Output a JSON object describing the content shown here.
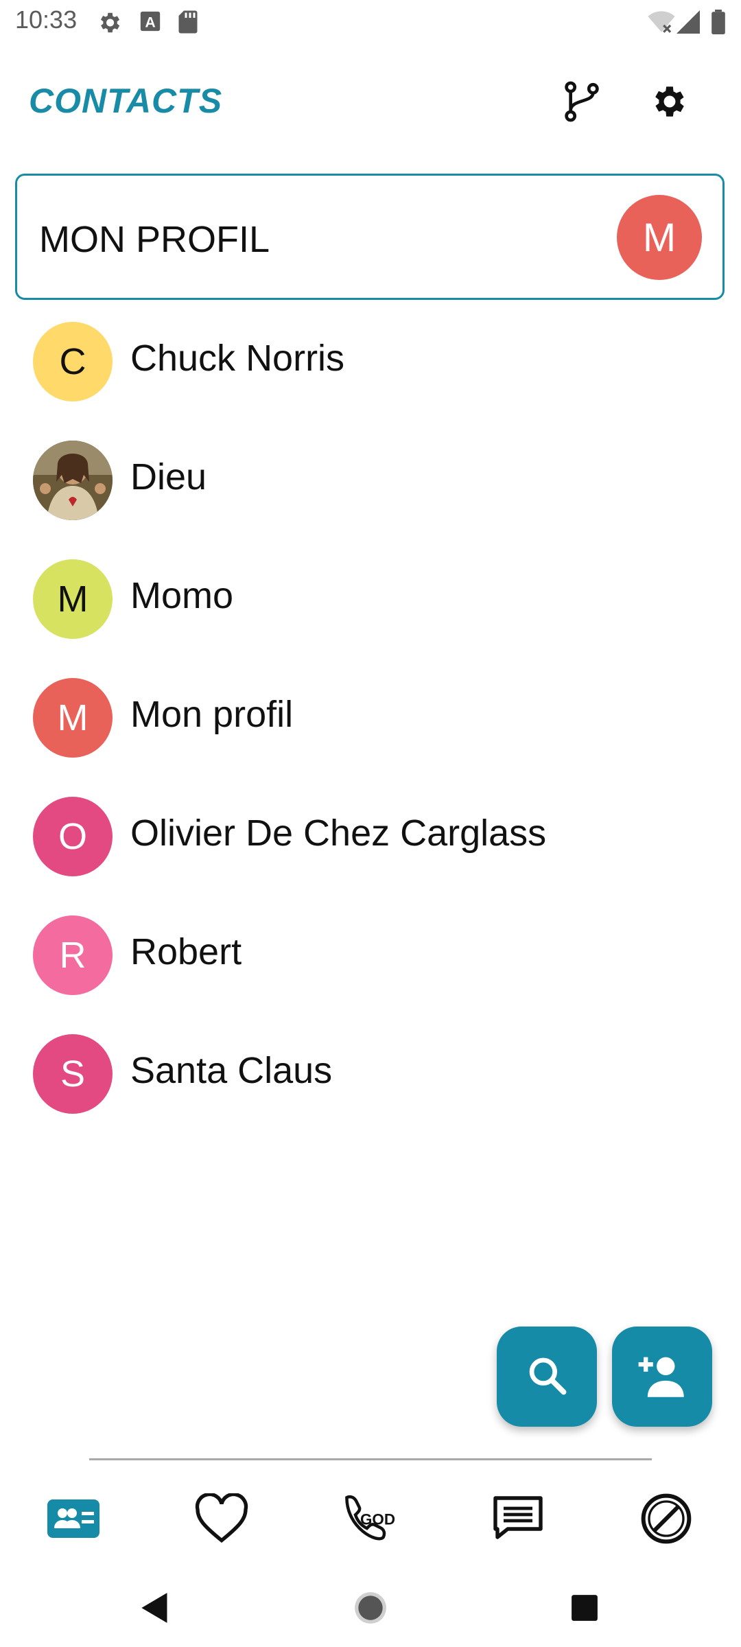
{
  "status_bar": {
    "time": "10:33",
    "icons": [
      "settings-icon",
      "keyboard-a-icon",
      "sd-card-icon",
      "wifi-off-icon",
      "signal-icon",
      "battery-icon"
    ]
  },
  "app_bar": {
    "title": "CONTACTS",
    "actions": [
      "merge-icon",
      "settings-gear-icon"
    ]
  },
  "profile_card": {
    "label": "MON PROFIL",
    "avatar_letter": "M",
    "avatar_color": "#e8625a"
  },
  "contacts": [
    {
      "name": "Chuck Norris",
      "letter": "C",
      "color": "#ffd96a",
      "text_color": "#111111"
    },
    {
      "name": "Dieu",
      "letter": "",
      "color": "#8a6a3a",
      "photo": true
    },
    {
      "name": "Momo",
      "letter": "M",
      "color": "#d6e260",
      "text_color": "#111111"
    },
    {
      "name": "Mon profil",
      "letter": "M",
      "color": "#e8625a",
      "text_color": "#ffffff"
    },
    {
      "name": "Olivier De Chez Carglass",
      "letter": "O",
      "color": "#e44a82",
      "text_color": "#ffffff"
    },
    {
      "name": "Robert",
      "letter": "R",
      "color": "#f46b9f",
      "text_color": "#ffffff"
    },
    {
      "name": "Santa Claus",
      "letter": "S",
      "color": "#e44a82",
      "text_color": "#ffffff"
    }
  ],
  "fabs": [
    "search-icon",
    "add-contact-icon"
  ],
  "bottom_nav": {
    "items": [
      "contacts-icon",
      "favorites-heart-icon",
      "call-log-icon",
      "messages-icon",
      "blocked-icon"
    ],
    "active": "contacts-icon"
  },
  "colors": {
    "accent": "#188ba6",
    "fab": "#168ba8"
  }
}
